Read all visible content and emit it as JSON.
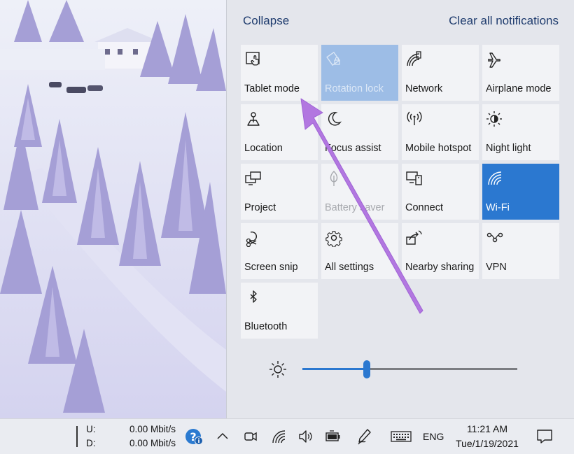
{
  "action_center": {
    "collapse_label": "Collapse",
    "clear_label": "Clear all notifications",
    "tiles": [
      {
        "label": "Tablet mode",
        "icon": "tablet-mode-icon",
        "state": "off"
      },
      {
        "label": "Rotation lock",
        "icon": "rotation-lock-icon",
        "state": "disabled-on"
      },
      {
        "label": "Network",
        "icon": "network-icon",
        "state": "off"
      },
      {
        "label": "Airplane mode",
        "icon": "airplane-icon",
        "state": "off"
      },
      {
        "label": "Location",
        "icon": "location-icon",
        "state": "off"
      },
      {
        "label": "Focus assist",
        "icon": "moon-icon",
        "state": "off"
      },
      {
        "label": "Mobile hotspot",
        "icon": "hotspot-icon",
        "state": "off"
      },
      {
        "label": "Night light",
        "icon": "night-light-icon",
        "state": "off"
      },
      {
        "label": "Project",
        "icon": "project-icon",
        "state": "off"
      },
      {
        "label": "Battery saver",
        "icon": "battery-saver-icon",
        "state": "disabled"
      },
      {
        "label": "Connect",
        "icon": "connect-icon",
        "state": "off"
      },
      {
        "label": "Wi-Fi",
        "icon": "wifi-icon",
        "state": "on"
      },
      {
        "label": "Screen snip",
        "icon": "screen-snip-icon",
        "state": "off"
      },
      {
        "label": "All settings",
        "icon": "gear-icon",
        "state": "off"
      },
      {
        "label": "Nearby sharing",
        "icon": "nearby-sharing-icon",
        "state": "off"
      },
      {
        "label": "VPN",
        "icon": "vpn-icon",
        "state": "off"
      },
      {
        "label": "Bluetooth",
        "icon": "bluetooth-icon",
        "state": "off"
      }
    ],
    "brightness": {
      "value_fraction": 0.3
    }
  },
  "taskbar": {
    "net_upload_label": "U:",
    "net_download_label": "D:",
    "net_upload_value": "0.00 Mbit/s",
    "net_download_value": "0.00 Mbit/s",
    "language": "ENG",
    "time": "11:21 AM",
    "date": "Tue/1/19/2021"
  },
  "colors": {
    "accent": "#2b78d0",
    "annotation_arrow": "#b277e0"
  }
}
